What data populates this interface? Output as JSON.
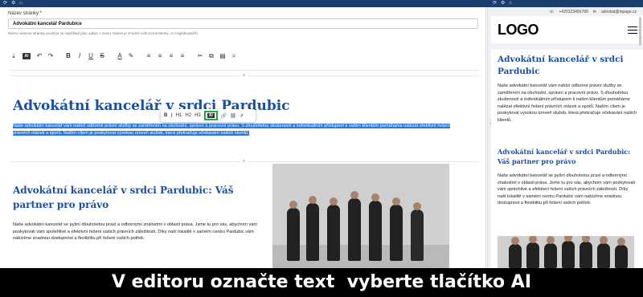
{
  "topbar": {
    "icons": [
      "refresh-icon",
      "settings-icon",
      "home-icon"
    ]
  },
  "editor": {
    "field_label": "Název stránky:*",
    "field_value": "Advokátní kancelář Pardubice",
    "field_help": "Název webové stránky, používá se například jako odkaz v menu. Název je vhodné volit srozumitelný, co nejjednodušší.",
    "toolbar_ai": "AI",
    "bubble": {
      "bold": "B",
      "italic": "I",
      "h1": "H1",
      "h2": "H2",
      "h3": "H3",
      "ai": "AI"
    },
    "heading": "Advokátní kancelář v srdci Pardubic",
    "selected_paragraph": "Naše advokátní kancelář vám nabízí odborné právní služby se zaměřením na obchodní, správní a pracovní právo. S dlouholetou zkušeností a individuálním přístupem k našim klientům pomáháme nalézat efektivní řešení právních otázek a sporů. Naším cílem je poskytovat vysokou úroveň služeb, která překračuje očekávání našich klientů.",
    "heading2": "Advokátní kancelář v srdci Pardubic: Váš partner pro právo",
    "paragraph2": "Naše advokátní kancelář se pyšní dlouholetou praxí a odbornými znalostmi v oblasti práva. Jsme tu pro vás, abychom vám poskytovali vám spolehlivé a efektivní řešení vašich právních záležitostí. Díky naší lokalitě v samém centru Pardubic vám nabízíme snadnou dostupnost a flexibilitu při řešení vašich potřeb."
  },
  "preview": {
    "phone": "+420123456789",
    "email": "advokat@inpage.cz",
    "logo": "LOGO",
    "heading": "Advokátní kancelář v srdci Pardubic",
    "paragraph1": "Naše advokátní kancelář vám nabízí odborné právní služby se zaměřením na obchodní, správní a pracovní právo. S dlouholetou zkušeností a individuálním přístupem k našim klientům pomáháme nalézat efektivní řešení právních otázek a sporů. Naším cílem je poskytovat vysokou úroveň služeb, která překračuje očekávání našich klientů.",
    "heading2": "Advokátní kancelář v srdci Pardubic: Váš partner pro právo",
    "paragraph2": "Naše advokátní kancelář se pyšní dlouholetou praxí a odbornými znalostmi v oblasti práva. Jsme tu pro vás, abychom vám poskytovali vám spolehlivé a efektivní řešení vašich právních záležitostí. Díky naší lokalitě v samém centru Pardubic vám nabízíme snadnou dostupnost a flexibilitu při řešení vašich potřeb."
  },
  "caption": "V editoru označte text  vyberte tlačítko AI",
  "colors": {
    "heading": "#1c4fa1",
    "selection": "#2b78d6",
    "highlight": "#27a743",
    "topbar": "#1a3d6e"
  }
}
